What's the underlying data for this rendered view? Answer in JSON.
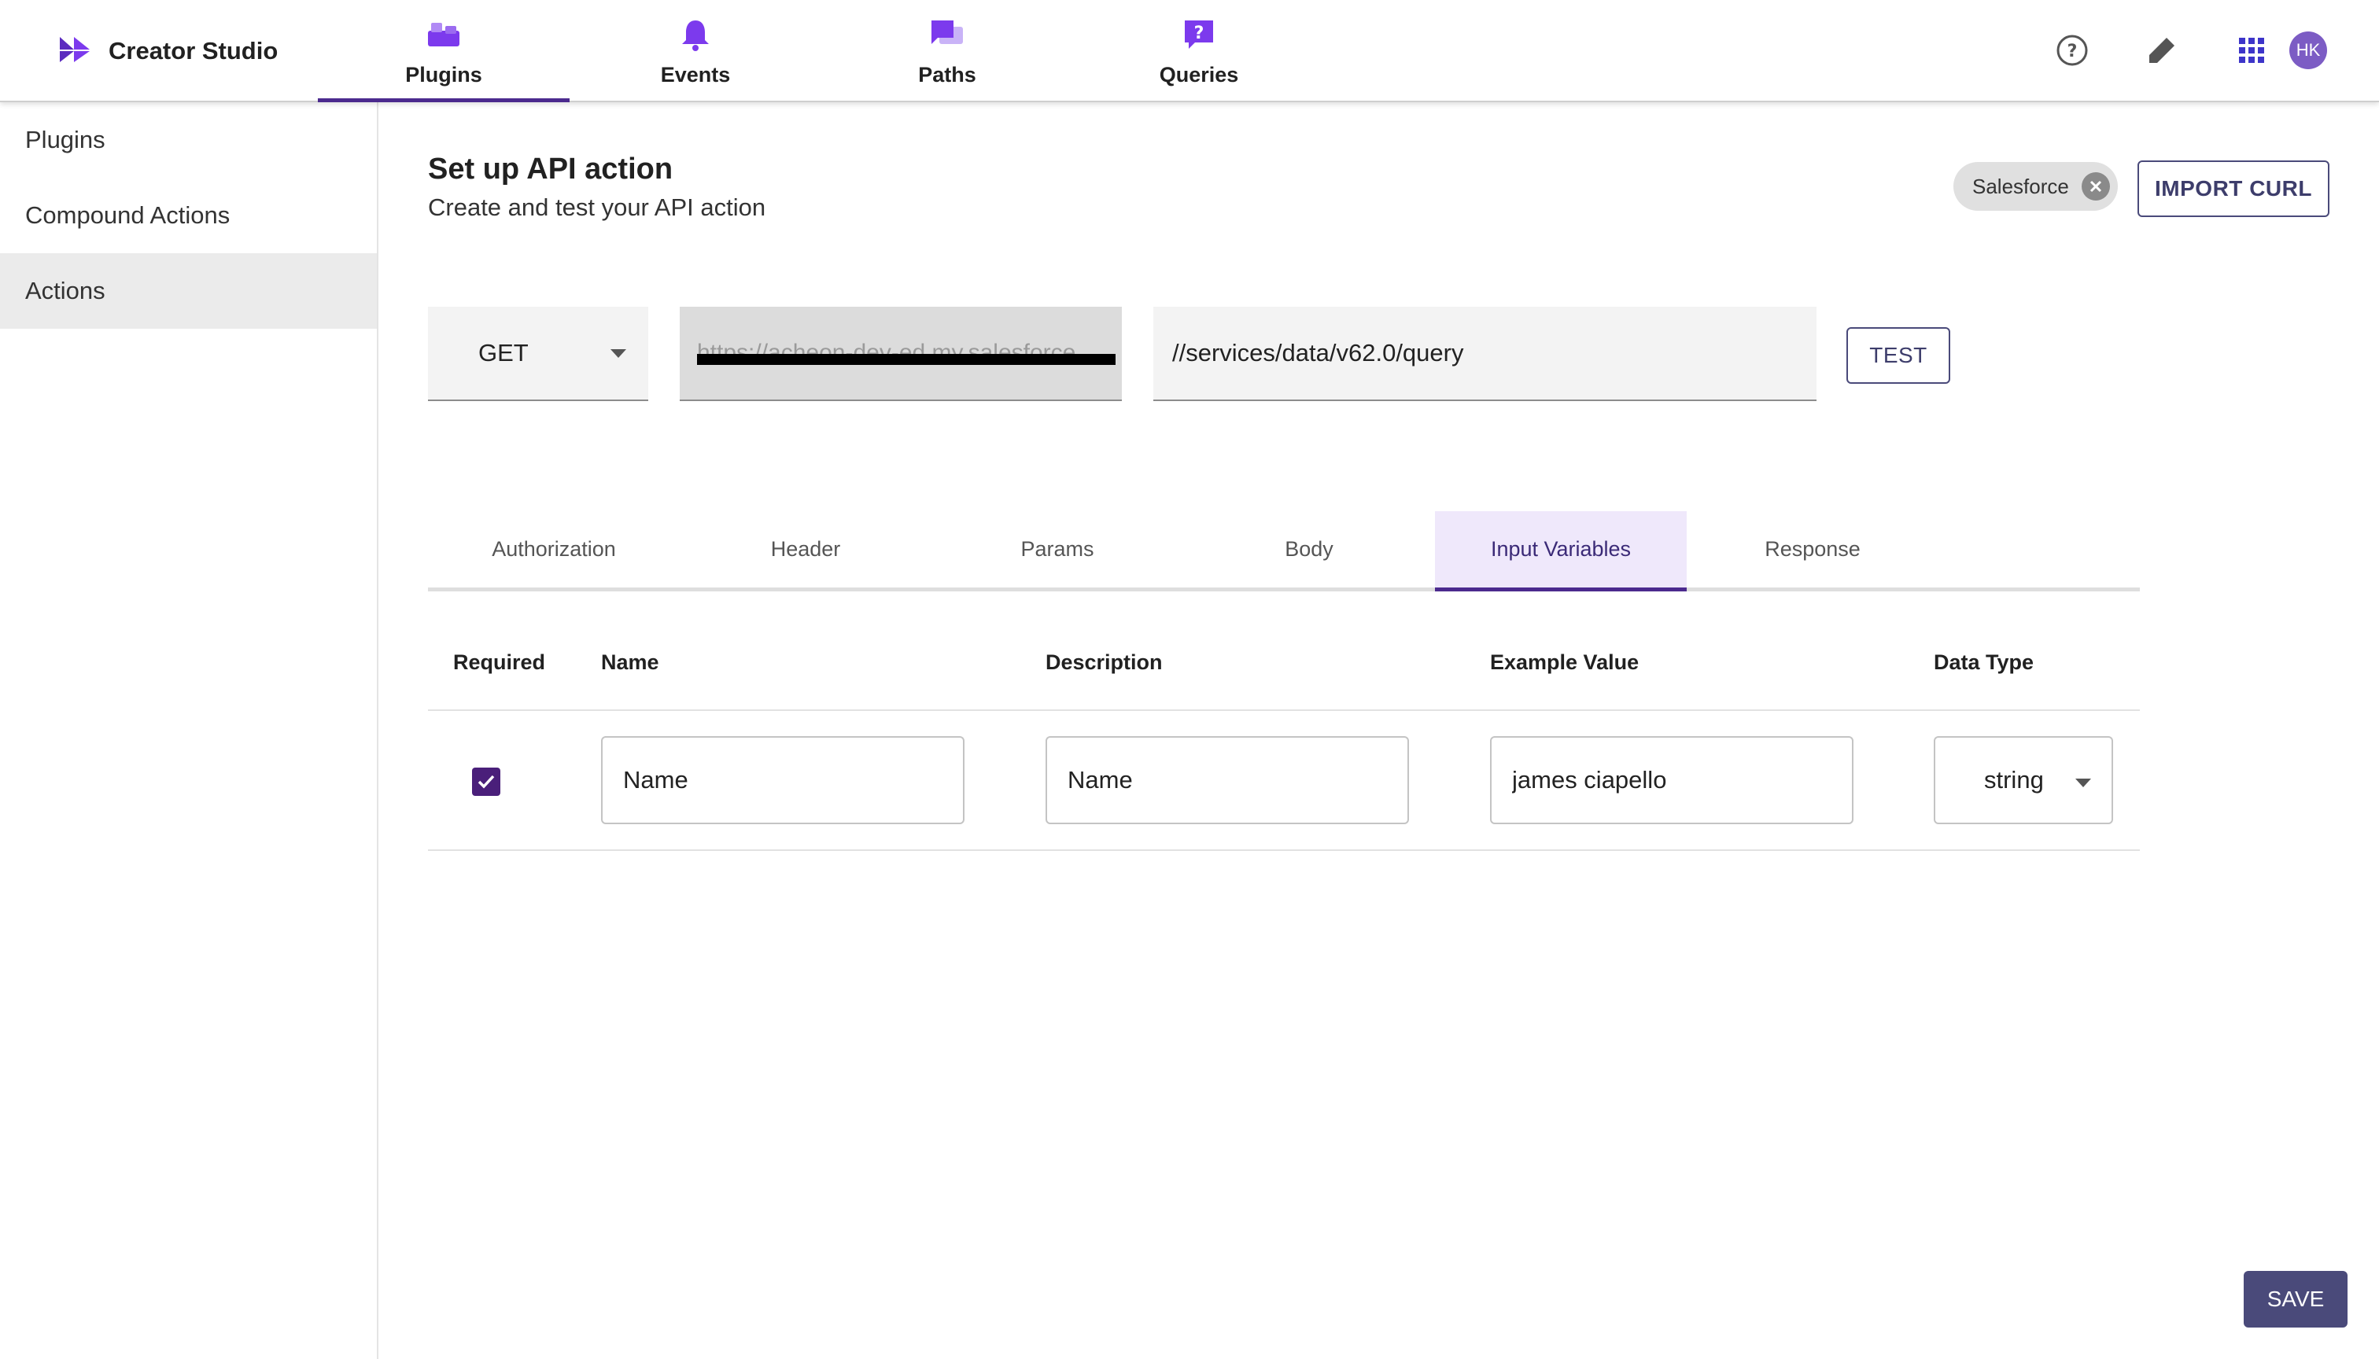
{
  "app": {
    "title": "Creator Studio"
  },
  "nav": {
    "tabs": [
      {
        "label": "Plugins",
        "icon": "plugins-icon",
        "active": true
      },
      {
        "label": "Events",
        "icon": "bell-icon",
        "active": false
      },
      {
        "label": "Paths",
        "icon": "chat-bubbles-icon",
        "active": false
      },
      {
        "label": "Queries",
        "icon": "question-bubble-icon",
        "active": false
      }
    ],
    "avatar_initials": "HK"
  },
  "sidebar": {
    "items": [
      {
        "label": "Plugins",
        "selected": false
      },
      {
        "label": "Compound Actions",
        "selected": false
      },
      {
        "label": "Actions",
        "selected": true
      }
    ]
  },
  "page": {
    "title": "Set up API action",
    "subtitle": "Create and test your API action",
    "connector_chip": "Salesforce",
    "import_label": "IMPORT CURL"
  },
  "request": {
    "method": "GET",
    "base_url": "https://acheon-dev-ed.my.salesforce",
    "path": "//services/data/v62.0/query",
    "test_label": "TEST"
  },
  "tabs": [
    {
      "label": "Authorization",
      "active": false
    },
    {
      "label": "Header",
      "active": false
    },
    {
      "label": "Params",
      "active": false
    },
    {
      "label": "Body",
      "active": false
    },
    {
      "label": "Input Variables",
      "active": true
    },
    {
      "label": "Response",
      "active": false
    }
  ],
  "input_variables": {
    "columns": [
      "Required",
      "Name",
      "Description",
      "Example Value",
      "Data Type"
    ],
    "rows": [
      {
        "required": true,
        "name": "Name",
        "description": "Name",
        "example": "james ciapello",
        "data_type": "string"
      }
    ]
  },
  "footer": {
    "save_label": "SAVE"
  },
  "colors": {
    "brand": "#7c3aed",
    "accent": "#4b2a8e",
    "button": "#4a4a7a",
    "active_tab_bg": "#efe8fb"
  }
}
